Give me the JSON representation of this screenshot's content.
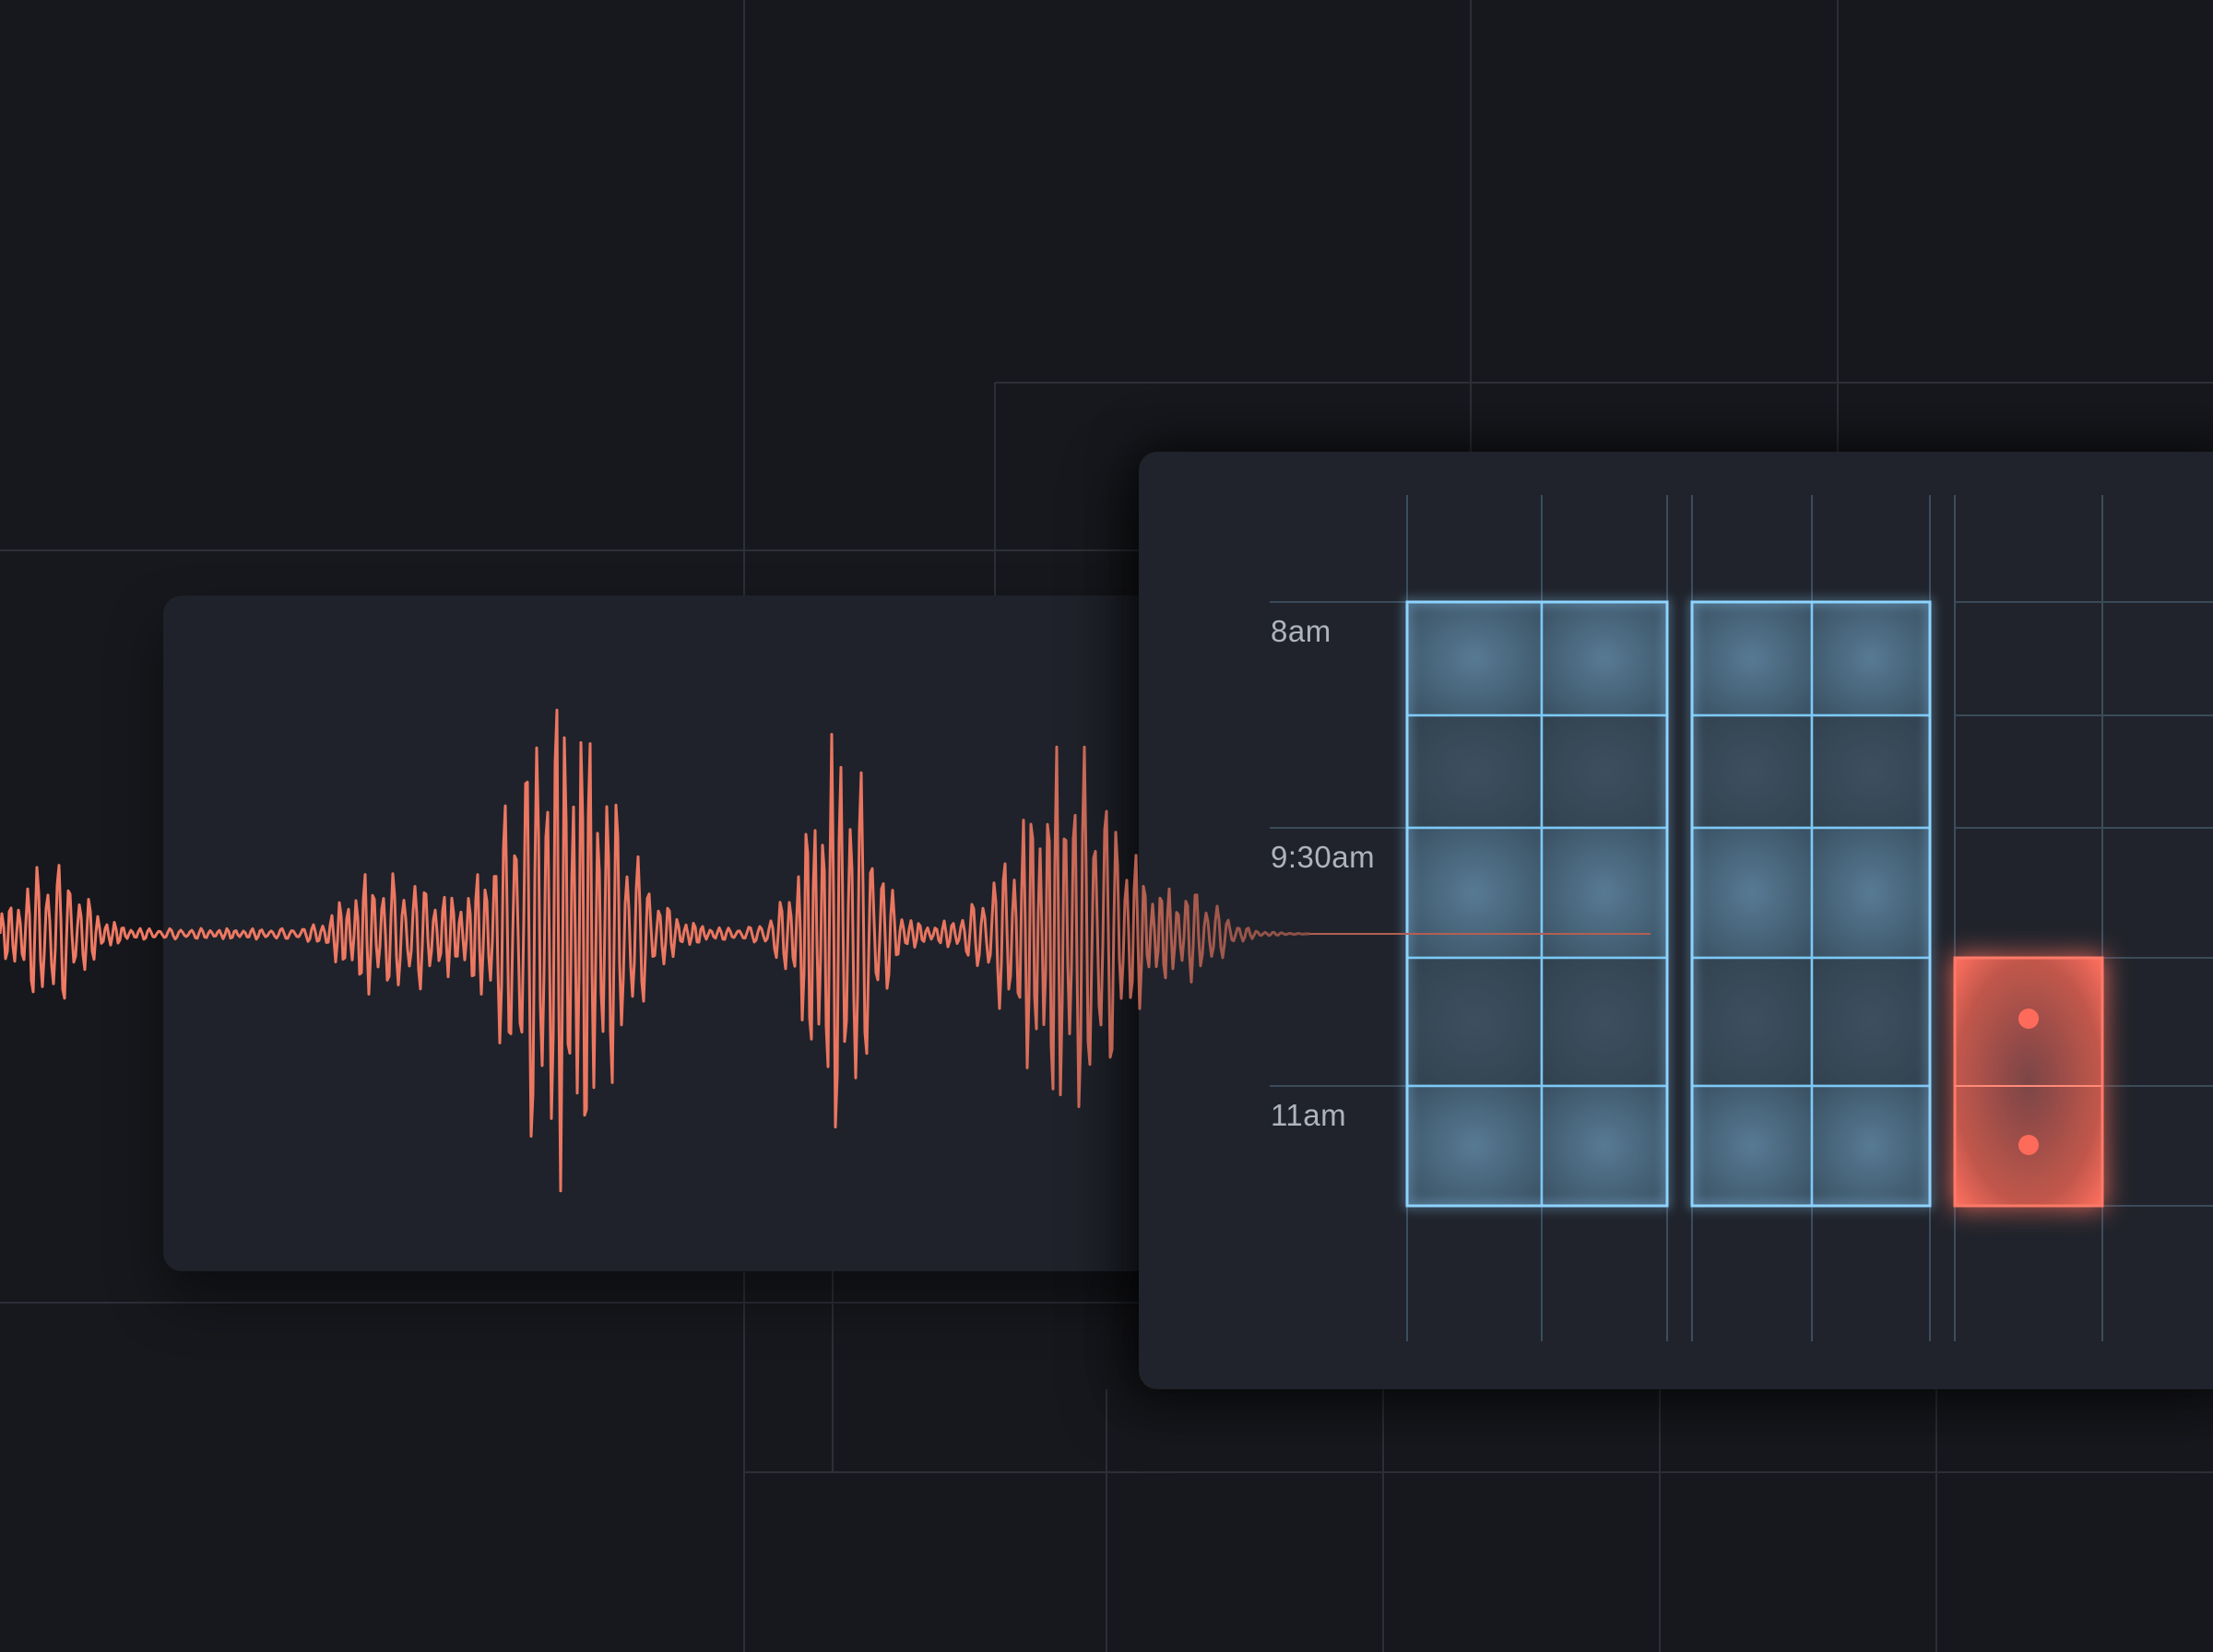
{
  "schedule": {
    "time_labels": [
      "8am",
      "9:30am",
      "11am"
    ]
  },
  "colors": {
    "background": "#17181d",
    "card": "#20232b",
    "waveform": "#f07a64",
    "availability_blue": "#7cc8f5",
    "booked_red": "#ff6b5a"
  },
  "icons": [
    "slot-dot-icon"
  ]
}
